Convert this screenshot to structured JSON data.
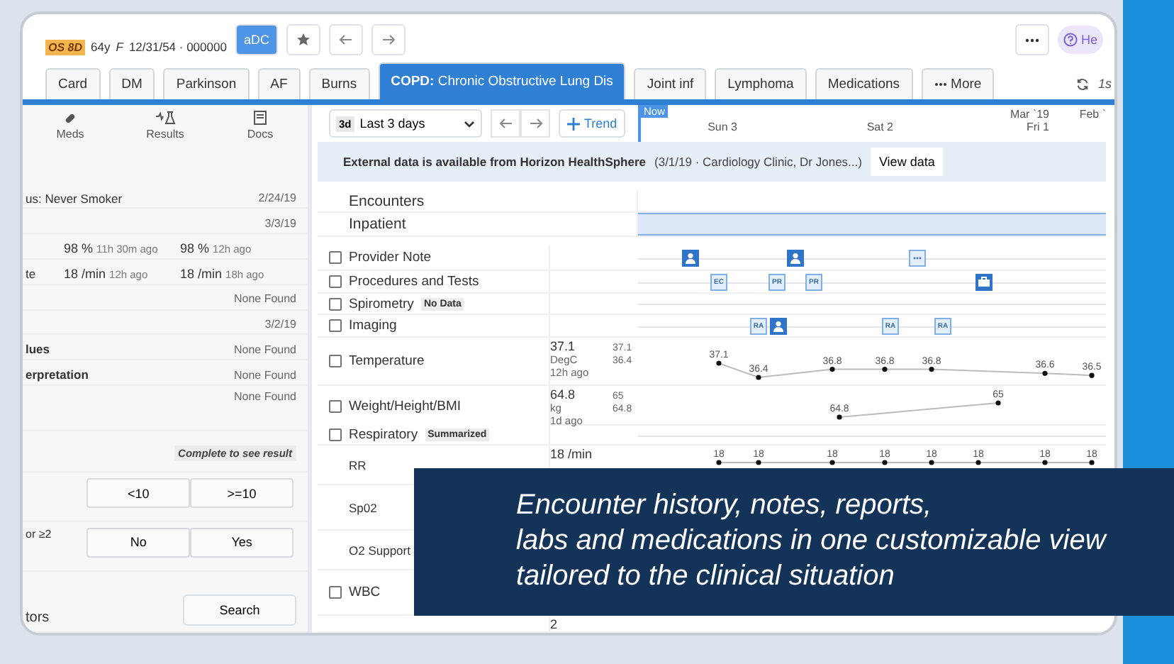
{
  "patient": {
    "badge": "OS 8D",
    "age": "64y",
    "sex": "F",
    "dob_id": "12/31/54 · 000000"
  },
  "header_button": "aDC",
  "help": "He",
  "tabs": [
    {
      "label": "Card",
      "selected": false
    },
    {
      "label": "DM",
      "selected": false
    },
    {
      "label": "Parkinson",
      "selected": false
    },
    {
      "label": "AF",
      "selected": false
    },
    {
      "label": "Burns",
      "selected": false
    },
    {
      "label": "**COPD:** Chronic Obstructive Lung Dis",
      "selected": true
    },
    {
      "label": "Joint inf",
      "selected": false
    },
    {
      "label": "Lymphoma",
      "selected": false
    },
    {
      "label": "Medications",
      "selected": false
    },
    {
      "label": "More",
      "selected": false
    }
  ],
  "refresh_label": "1s",
  "left_toolbar": [
    {
      "label": "Meds"
    },
    {
      "label": "Results"
    },
    {
      "label": "Docs"
    }
  ],
  "left_rows": [
    {
      "kind": "entry",
      "label": "us: Never Smoker",
      "value": "2/24/19"
    },
    {
      "kind": "entry",
      "label": "",
      "value": "3/3/19"
    },
    {
      "kind": "vitals",
      "label": "",
      "readings": [
        {
          "value": "98 %",
          "ago": "11h 30m ago"
        },
        {
          "value": "98 %",
          "ago": "12h ago"
        }
      ]
    },
    {
      "kind": "vitals",
      "label": "te",
      "readings": [
        {
          "value": "18 /min",
          "ago": "12h ago"
        },
        {
          "value": "18 /min",
          "ago": "18h ago"
        }
      ]
    },
    {
      "kind": "entry",
      "label": "",
      "value": "None Found"
    },
    {
      "kind": "entry",
      "label": "",
      "value": "3/2/19"
    },
    {
      "kind": "entry",
      "label": "lues",
      "value": "None Found"
    },
    {
      "kind": "entry",
      "label": "erpretation",
      "value": "None Found"
    },
    {
      "kind": "tall",
      "label": "",
      "value": "None Found"
    },
    {
      "kind": "badge",
      "label": "Complete to see result"
    },
    {
      "kind": "choices",
      "label": "",
      "options": [
        "<10",
        ">=10"
      ]
    },
    {
      "kind": "choices",
      "label": "or ≥2",
      "options": [
        "No",
        "Yes"
      ]
    },
    {
      "kind": "search",
      "label": "tors",
      "button": "Search"
    }
  ],
  "range": {
    "chip": "3d",
    "label": "Last 3 days"
  },
  "trend_button": "Trend",
  "timeline_header": {
    "now": "Now",
    "days": [
      {
        "label": "Sun 3"
      },
      {
        "label": "Sat 2"
      },
      {
        "month": "Mar `19",
        "label": "Fri 1"
      },
      {
        "month": "Feb `"
      }
    ]
  },
  "banner": {
    "title": "External data is available from Horizon HealthSphere",
    "detail": "(3/1/19 · Cardiology Clinic, Dr Jones...)",
    "button": "View data"
  },
  "encounters": [
    {
      "kind": "header",
      "label": "Encounters"
    },
    {
      "kind": "band",
      "label": "Inpatient"
    }
  ],
  "rows": [
    {
      "kind": "events",
      "label": "Provider Note",
      "checked": false,
      "events": [
        {
          "kind": "person"
        },
        {
          "kind": "person"
        },
        {
          "kind": "note"
        }
      ]
    },
    {
      "kind": "events",
      "label": "Procedures and Tests",
      "checked": false,
      "events": [
        {
          "kind": "code",
          "label": "EC"
        },
        {
          "kind": "code",
          "label": "PR"
        },
        {
          "kind": "code",
          "label": "PR"
        },
        {
          "kind": "case"
        }
      ]
    },
    {
      "kind": "events",
      "label": "Spirometry",
      "tag": "No Data",
      "checked": false,
      "events": []
    },
    {
      "kind": "events",
      "label": "Imaging",
      "checked": false,
      "events": [
        {
          "kind": "code",
          "label": "RA"
        },
        {
          "kind": "person"
        },
        {
          "kind": "code",
          "label": "RA"
        },
        {
          "kind": "code",
          "label": "RA"
        }
      ]
    },
    {
      "kind": "vital",
      "label": "Temperature",
      "checked": false,
      "latest": [
        "37.1",
        "DegC",
        "12h ago"
      ],
      "range": [
        "37.1",
        "36.4"
      ],
      "points": [
        "37.1",
        "36.4",
        "36.8",
        "36.8",
        "36.8",
        "36.6",
        "36.5"
      ]
    },
    {
      "kind": "vital",
      "label": "Weight/Height/BMI",
      "checked": false,
      "latest": [
        "64.8",
        "kg",
        "1d ago"
      ],
      "range": [
        "65",
        "64.8"
      ],
      "points": [
        "64.8",
        "65"
      ]
    },
    {
      "kind": "events",
      "label": "Respiratory",
      "tag": "Summarized",
      "checked": false,
      "events": []
    },
    {
      "kind": "sub",
      "label": "RR",
      "latest": [
        "18 /min"
      ],
      "points": [
        "18",
        "18",
        "18",
        "18",
        "18",
        "18",
        "18",
        "18"
      ]
    },
    {
      "kind": "sub",
      "label": "Sp02",
      "latest": []
    },
    {
      "kind": "sub",
      "label": "O2 Support",
      "latest": []
    },
    {
      "kind": "events",
      "label": "WBC",
      "checked": false,
      "events": []
    },
    {
      "kind": "sub",
      "label": "",
      "latest": [
        "2"
      ]
    }
  ],
  "caption": [
    "Encounter history, notes, reports,",
    "labs and medications in one customizable view",
    "tailored to the clinical situation"
  ]
}
